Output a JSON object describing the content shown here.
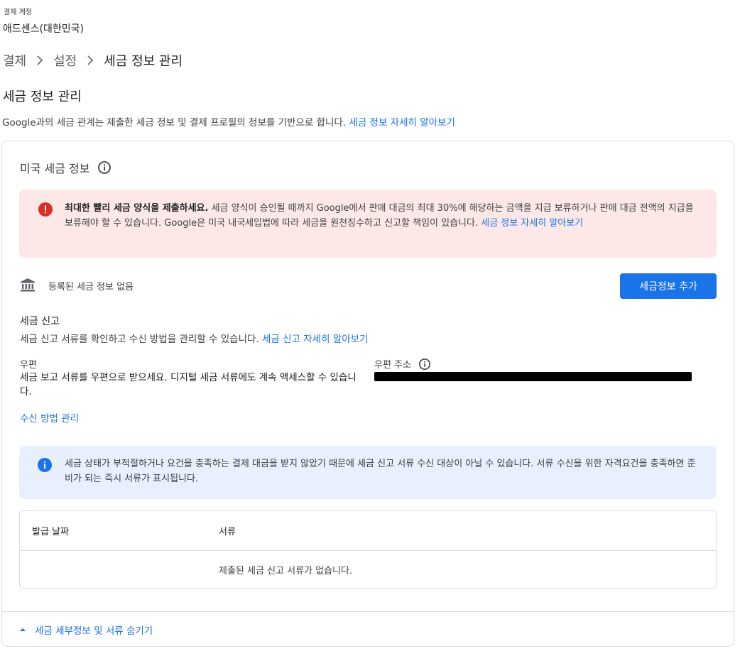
{
  "account": {
    "label": "결제 계정",
    "name": "애드센스(대한민국)"
  },
  "breadcrumb": {
    "items": [
      "결제",
      "설정"
    ],
    "current": "세금 정보 관리"
  },
  "page": {
    "title": "세금 정보 관리",
    "intro": "Google과의 세금 관계는 제출한 세금 정보 및 결제 프로필의 정보를 기반으로 합니다.",
    "intro_link": "세금 정보 자세히 알아보기"
  },
  "us_tax": {
    "title": "미국 세금 정보",
    "alert": {
      "bold": "최대한 빨리 세금 양식을 제출하세요.",
      "text": " 세금 양식이 승인될 때까지 Google에서 판매 대금의 최대 30%에 해당하는 금액을 지급 보류하거나 판매 대금 전액의 지급을 보류해야 할 수 있습니다. Google은 미국 내국세입법에 따라 세금을 원천징수하고 신고할 책임이 있습니다. ",
      "link": "세금 정보 자세히 알아보기"
    },
    "status": "등록된 세금 정보 없음",
    "add_button": "세금정보 추가"
  },
  "filing": {
    "title": "세금 신고",
    "desc": "세금 신고 서류를 확인하고 수신 방법을 관리할 수 있습니다.",
    "desc_link": "세금 신고 자세히 알아보기",
    "mail_label": "우편",
    "mail_desc": "세금 보고 서류를 우편으로 받으세요. 디지털 세금 서류에도 계속 액세스할 수 있습니다.",
    "address_label": "우편 주소",
    "manage_link": "수신 방법 관리"
  },
  "info_alert": "세금 상태가 부적절하거나 요건을 충족하는 결제 대금을 받지 않았기 때문에 세금 신고 서류 수신 대상이 아닐 수 있습니다. 서류 수신을 위한 자격요건을 충족하면 준비가 되는 즉시 서류가 표시됩니다.",
  "documents_table": {
    "columns": [
      "발급 날짜",
      "서류"
    ],
    "empty": "제출된 세금 신고 서류가 없습니다."
  },
  "toggle": {
    "label": "세금 세부정보 및 서류 숨기기"
  },
  "icons": {
    "info": "info-outline-icon",
    "error": "error-icon",
    "bank": "bank-icon",
    "info_filled": "info-filled-icon",
    "chevron": "chevron-right-icon",
    "collapse": "arrow-up-icon"
  },
  "colors": {
    "primary": "#1a73e8",
    "error": "#d93025",
    "error_bg": "#fce8e6",
    "info_bg": "#e8f0fe"
  }
}
